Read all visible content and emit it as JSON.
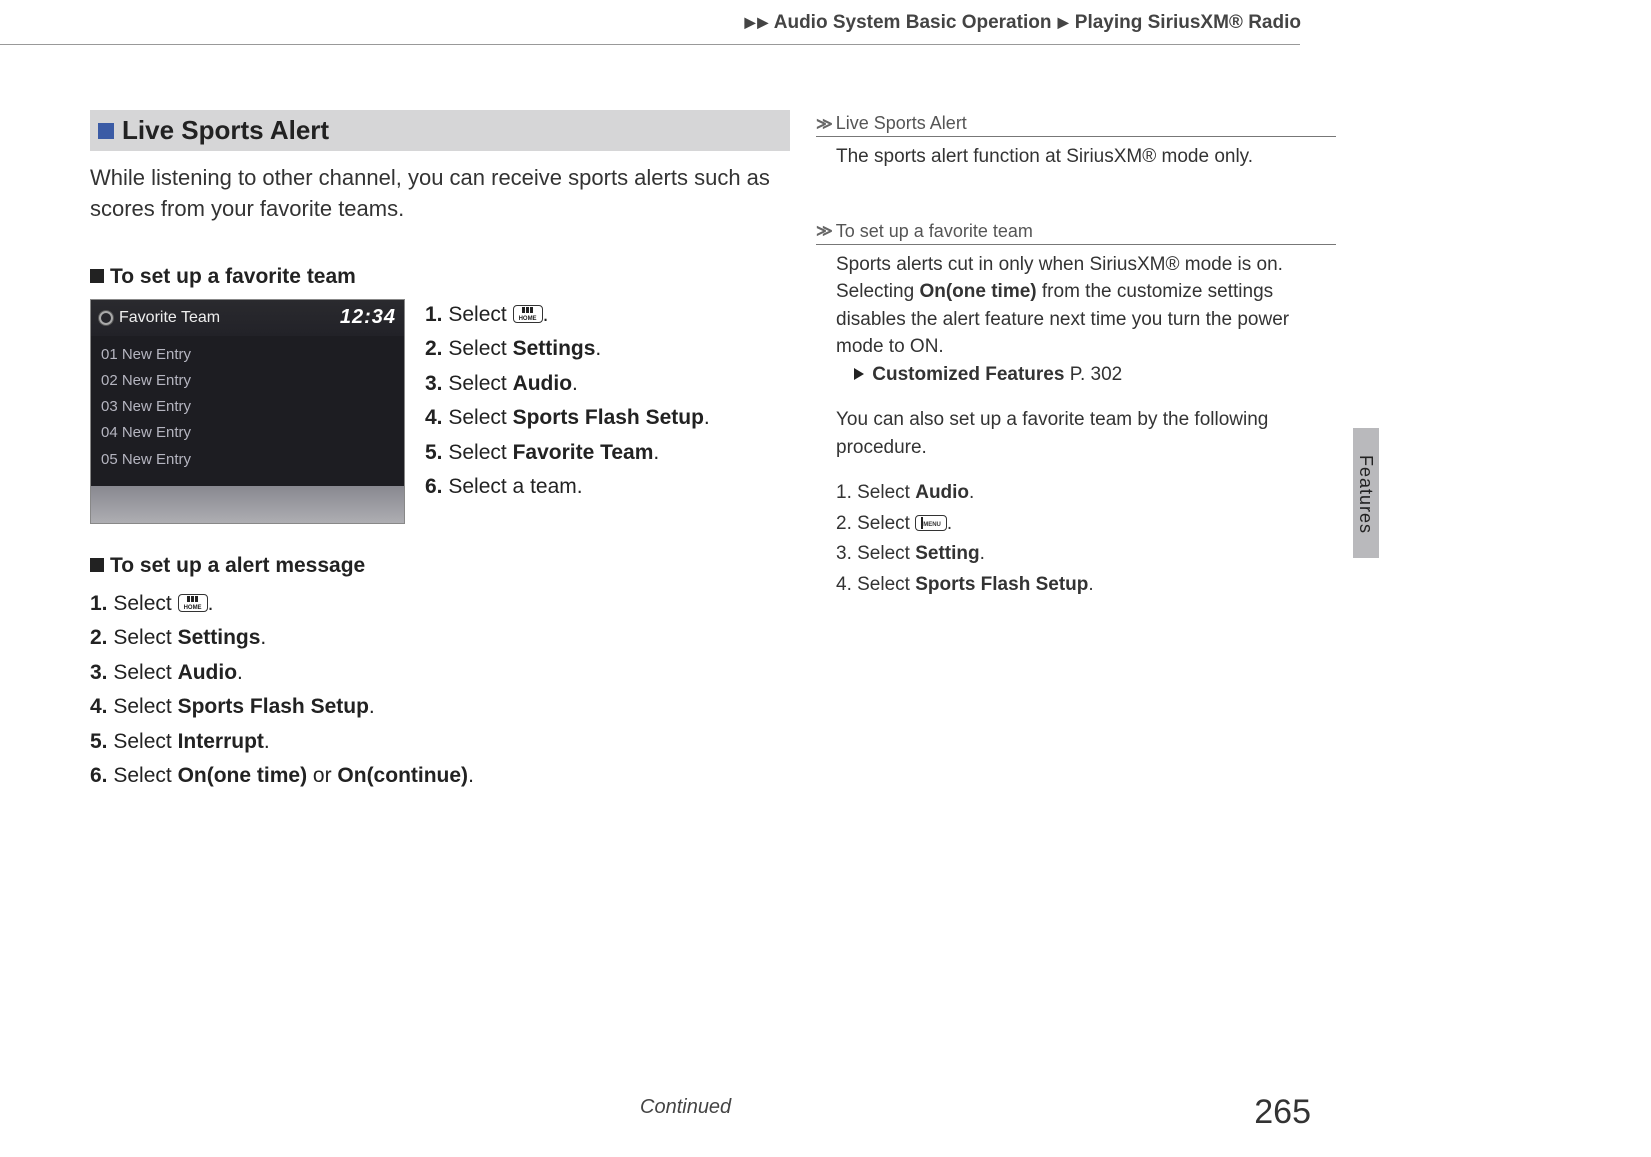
{
  "breadcrumb": {
    "part1": "Audio System Basic Operation",
    "part2": "Playing SiriusXM® Radio"
  },
  "main": {
    "section_title": "Live Sports Alert",
    "intro": "While listening to other channel, you can receive sports alerts such as scores from your favorite teams.",
    "fav_team_heading": "To set up a favorite team",
    "screenshot": {
      "title": "Favorite Team",
      "clock": "12:34",
      "entries": [
        "01 New Entry",
        "02 New Entry",
        "03 New Entry",
        "04 New Entry",
        "05 New Entry"
      ]
    },
    "fav_steps": {
      "s1_pre": "Select ",
      "s2_pre": "Select ",
      "s2_b": "Settings",
      "s2_post": ".",
      "s3_pre": "Select ",
      "s3_b": "Audio",
      "s3_post": ".",
      "s4_pre": "Select ",
      "s4_b": "Sports Flash Setup",
      "s4_post": ".",
      "s5_pre": "Select ",
      "s5_b": "Favorite Team",
      "s5_post": ".",
      "s6": "Select a team."
    },
    "alert_heading": "To set up a alert message",
    "alert_steps": {
      "s1_pre": "Select ",
      "s2_pre": "Select ",
      "s2_b": "Settings",
      "s2_post": ".",
      "s3_pre": "Select ",
      "s3_b": "Audio",
      "s3_post": ".",
      "s4_pre": "Select ",
      "s4_b": "Sports Flash Setup",
      "s4_post": ".",
      "s5_pre": "Select ",
      "s5_b": "Interrupt",
      "s5_post": ".",
      "s6_pre": "Select ",
      "s6_b1": "On(one time)",
      "s6_mid": " or ",
      "s6_b2": "On(continue)",
      "s6_post": "."
    }
  },
  "notes": {
    "h1": "Live Sports Alert",
    "p1": "The sports alert function at SiriusXM® mode only.",
    "h2": "To set up a favorite team",
    "p2a": "Sports alerts cut in only when SiriusXM® mode is on. Selecting ",
    "p2b": "On(one time)",
    "p2c": " from the customize settings disables the alert feature next time you turn the power mode to ON.",
    "ref_label": "Customized Features",
    "ref_page": " P. 302",
    "p3": "You can also set up a favorite team by the following procedure.",
    "alt": {
      "s1_pre": "1.  Select ",
      "s1_b": "Audio",
      "s1_post": ".",
      "s2_pre": "2.  Select ",
      "s3_pre": "3.  Select ",
      "s3_b": "Setting",
      "s3_post": ".",
      "s4_pre": "4.  Select ",
      "s4_b": "Sports Flash Setup",
      "s4_post": "."
    }
  },
  "home_label": "HOME",
  "menu_label": "MENU",
  "side_tab": "Features",
  "continued": "Continued",
  "page_number": "265"
}
